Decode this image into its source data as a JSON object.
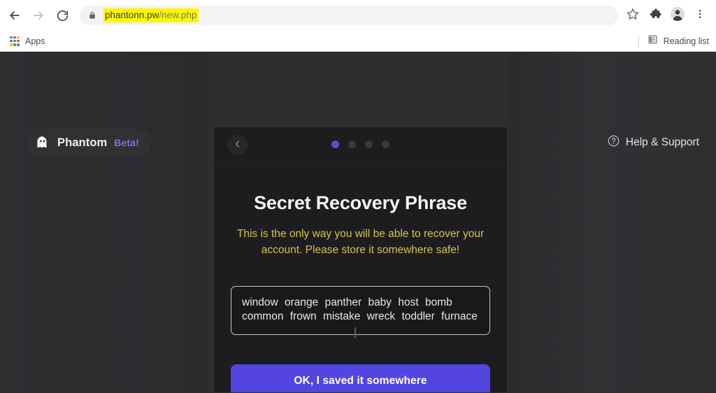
{
  "browser": {
    "nav": {
      "back_icon": "arrow-left-icon",
      "forward_icon": "arrow-right-icon",
      "reload_icon": "reload-icon"
    },
    "omnibox": {
      "lock_icon": "lock-icon",
      "url_domain": "phantonn.pw",
      "url_path": "/new.php",
      "highlight_color": "#fdf500"
    },
    "toolbar_right": [
      {
        "name": "bookmark-star-icon",
        "label": "Bookmark this tab"
      },
      {
        "name": "extensions-puzzle-icon",
        "label": "Extensions"
      },
      {
        "name": "profile-avatar-icon",
        "label": "Profile"
      },
      {
        "name": "chrome-menu-icon",
        "label": "Customize and control Google Chrome"
      }
    ],
    "bookmarks_bar": {
      "apps_label": "Apps",
      "apps_icon": "apps-grid-icon",
      "reading_list_label": "Reading list",
      "reading_list_icon": "reading-list-icon"
    }
  },
  "page": {
    "background_color": "#2e2e31",
    "brand": {
      "logo_icon": "phantom-ghost-icon",
      "name": "Phantom",
      "beta_label": "Beta!",
      "beta_color": "#7a6fe0"
    },
    "help": {
      "icon": "question-circle-icon",
      "label": "Help & Support"
    }
  },
  "modal": {
    "background_color": "#1d1d1f",
    "header": {
      "back_icon": "chevron-left-icon",
      "steps": [
        {
          "active": true
        },
        {
          "active": false
        },
        {
          "active": false
        },
        {
          "active": false
        }
      ],
      "active_dot_color": "#5a4ce0",
      "inactive_dot_color": "#3a3a3d"
    },
    "title": "Secret Recovery Phrase",
    "warning": "This is the only way you will be able to recover your account. Please store it somewhere safe!",
    "warning_color": "#d6c24e",
    "seed_phrase": {
      "words": [
        "window",
        "orange",
        "panther",
        "baby",
        "host",
        "bomb",
        "common",
        "frown",
        "mistake",
        "wreck",
        "toddler",
        "furnace"
      ],
      "text": "window  orange  panther  baby  host  bomb  common  frown  mistake  wreck  toddler  furnace"
    },
    "primary_button": {
      "label": "OK, I saved it somewhere",
      "color": "#5345e0"
    }
  }
}
